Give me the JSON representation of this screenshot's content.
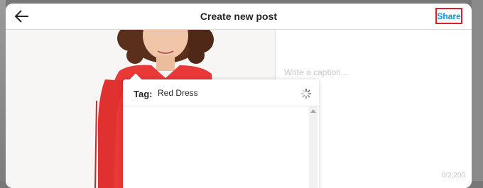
{
  "header": {
    "title": "Create new post",
    "back_icon": "arrow-left-icon",
    "share_label": "Share",
    "share_color": "#0095f6",
    "highlight_color": "#d6202a"
  },
  "caption": {
    "placeholder": "Write a caption...",
    "char_count": "0/2,200"
  },
  "tag": {
    "label": "Tag:",
    "value": "Red Dress",
    "loading_icon": "spinner-icon"
  },
  "photo": {
    "subject": "woman-in-red-dress-icon",
    "dress_color": "#e83838"
  }
}
